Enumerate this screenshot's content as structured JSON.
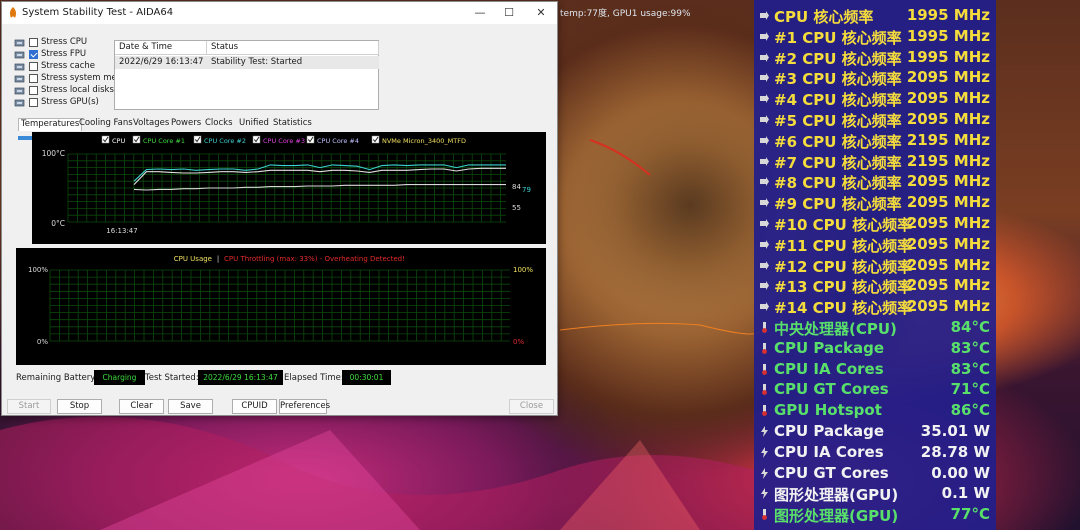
{
  "background": {
    "overlay_text": "temp:77度, GPU1 usage:99%"
  },
  "osd": {
    "rows": [
      {
        "icon": "arrow-right-icon",
        "label": "CPU 核心频率",
        "value": "1995 MHz",
        "color": "#f4dc3c"
      },
      {
        "icon": "arrow-right-icon",
        "label": "#1 CPU 核心频率",
        "value": "1995 MHz",
        "color": "#f4dc3c"
      },
      {
        "icon": "arrow-right-icon",
        "label": "#2 CPU 核心频率",
        "value": "1995 MHz",
        "color": "#f4dc3c"
      },
      {
        "icon": "arrow-right-icon",
        "label": "#3 CPU 核心频率",
        "value": "2095 MHz",
        "color": "#f4dc3c"
      },
      {
        "icon": "arrow-right-icon",
        "label": "#4 CPU 核心频率",
        "value": "2095 MHz",
        "color": "#f4dc3c"
      },
      {
        "icon": "arrow-right-icon",
        "label": "#5 CPU 核心频率",
        "value": "2095 MHz",
        "color": "#f4dc3c"
      },
      {
        "icon": "arrow-right-icon",
        "label": "#6 CPU 核心频率",
        "value": "2195 MHz",
        "color": "#f4dc3c"
      },
      {
        "icon": "arrow-right-icon",
        "label": "#7 CPU 核心频率",
        "value": "2195 MHz",
        "color": "#f4dc3c"
      },
      {
        "icon": "arrow-right-icon",
        "label": "#8 CPU 核心频率",
        "value": "2095 MHz",
        "color": "#f4dc3c"
      },
      {
        "icon": "arrow-right-icon",
        "label": "#9 CPU 核心频率",
        "value": "2095 MHz",
        "color": "#f4dc3c"
      },
      {
        "icon": "arrow-right-icon",
        "label": "#10 CPU 核心频率",
        "value": "2095 MHz",
        "color": "#f4dc3c"
      },
      {
        "icon": "arrow-right-icon",
        "label": "#11 CPU 核心频率",
        "value": "2095 MHz",
        "color": "#f4dc3c"
      },
      {
        "icon": "arrow-right-icon",
        "label": "#12 CPU 核心频率",
        "value": "2095 MHz",
        "color": "#f4dc3c"
      },
      {
        "icon": "arrow-right-icon",
        "label": "#13 CPU 核心频率",
        "value": "2095 MHz",
        "color": "#f4dc3c"
      },
      {
        "icon": "arrow-right-icon",
        "label": "#14 CPU 核心频率",
        "value": "2095 MHz",
        "color": "#f4dc3c"
      },
      {
        "icon": "thermometer-icon",
        "label": "中央处理器(CPU)",
        "value": "84°C",
        "color": "#59e06b"
      },
      {
        "icon": "thermometer-icon",
        "label": "CPU Package",
        "value": "83°C",
        "color": "#59e06b"
      },
      {
        "icon": "thermometer-icon",
        "label": "CPU IA Cores",
        "value": "83°C",
        "color": "#59e06b"
      },
      {
        "icon": "thermometer-icon",
        "label": "CPU GT Cores",
        "value": "71°C",
        "color": "#59e06b"
      },
      {
        "icon": "thermometer-icon",
        "label": "GPU Hotspot",
        "value": "86°C",
        "color": "#59e06b"
      },
      {
        "icon": "power-icon",
        "label": "CPU Package",
        "value": "35.01 W",
        "color": "#f2f2f2"
      },
      {
        "icon": "power-icon",
        "label": "CPU IA Cores",
        "value": "28.78 W",
        "color": "#f2f2f2"
      },
      {
        "icon": "power-icon",
        "label": "CPU GT Cores",
        "value": "0.00 W",
        "color": "#f2f2f2"
      },
      {
        "icon": "power-icon",
        "label": "图形处理器(GPU)",
        "value": "0.1 W",
        "color": "#f2f2f2"
      },
      {
        "icon": "thermometer-icon",
        "label": "图形处理器(GPU)",
        "value": "77°C",
        "color": "#59e06b"
      }
    ]
  },
  "window": {
    "title": "System Stability Test - AIDA64",
    "checkboxes": [
      {
        "label": "Stress CPU",
        "checked": false,
        "icon": "cpu-icon"
      },
      {
        "label": "Stress FPU",
        "checked": true,
        "icon": "fpu-icon"
      },
      {
        "label": "Stress cache",
        "checked": false,
        "icon": "cache-icon"
      },
      {
        "label": "Stress system memory",
        "checked": false,
        "icon": "memory-icon"
      },
      {
        "label": "Stress local disks",
        "checked": false,
        "icon": "disk-icon"
      },
      {
        "label": "Stress GPU(s)",
        "checked": false,
        "icon": "gpu-icon"
      }
    ],
    "status_table": {
      "headers": [
        "Date & Time",
        "Status"
      ],
      "rows": [
        [
          "2022/6/29 16:13:47",
          "Stability Test: Started"
        ]
      ]
    },
    "tabs": [
      "Temperatures",
      "Cooling Fans",
      "Voltages",
      "Powers",
      "Clocks",
      "Unified",
      "Statistics"
    ],
    "active_tab": "Temperatures",
    "footer": {
      "battery_label": "Remaining Battery:",
      "battery_value": "Charging",
      "started_label": "Test Started:",
      "started_value": "2022/6/29 16:13:47",
      "elapsed_label": "Elapsed Time:",
      "elapsed_value": "00:30:01"
    },
    "buttons": {
      "start": "Start",
      "stop": "Stop",
      "clear": "Clear",
      "save": "Save",
      "cpuid": "CPUID",
      "preferences": "Preferences",
      "close": "Close"
    }
  },
  "chart_data": [
    {
      "type": "line",
      "legend": [
        {
          "name": "CPU",
          "color": "#ffffff"
        },
        {
          "name": "CPU Core #1",
          "color": "#3cdc3c"
        },
        {
          "name": "CPU Core #2",
          "color": "#3cd0d0"
        },
        {
          "name": "CPU Core #3",
          "color": "#e040e0"
        },
        {
          "name": "CPU Core #4",
          "color": "#c0c0ff"
        },
        {
          "name": "NVMe Micron_3400_MTFD",
          "color": "#f0e060"
        }
      ],
      "y_top_label": "100°C",
      "y_bottom_label": "0°C",
      "x_label": "16:13:47",
      "ylim": [
        0,
        100
      ],
      "end_labels": [
        "84",
        "79",
        "55"
      ],
      "series": [
        {
          "name": "CPU",
          "color": "#3cd0d0",
          "values": [
            60,
            77,
            78,
            77,
            78,
            76,
            77,
            78,
            78,
            76,
            78,
            84,
            83,
            83,
            84,
            80,
            84,
            83,
            82,
            77,
            83,
            84,
            83,
            84,
            84,
            84,
            80,
            84,
            84,
            84,
            84
          ]
        },
        {
          "name": "CPU Core #4",
          "color": "#e0e0e0",
          "values": [
            55,
            74,
            74,
            73,
            72,
            72,
            73,
            74,
            74,
            73,
            74,
            76,
            76,
            76,
            76,
            74,
            76,
            76,
            75,
            73,
            76,
            76,
            76,
            77,
            78,
            78,
            75,
            78,
            79,
            79,
            79
          ]
        },
        {
          "name": "NVMe Micron_3400_MTFD",
          "color": "#d8d8d8",
          "values": [
            48,
            47,
            48,
            48,
            49,
            49,
            50,
            50,
            50,
            51,
            51,
            52,
            52,
            52,
            53,
            53,
            53,
            54,
            54,
            54,
            54,
            54,
            55,
            55,
            55,
            55,
            55,
            55,
            55,
            55,
            55
          ]
        }
      ]
    },
    {
      "type": "line",
      "title_left": "CPU Usage",
      "title_sep": "|",
      "title_right": "CPU Throttling (max: 33%) - Overheating Detected!",
      "y_left_top": "100%",
      "y_left_bottom": "0%",
      "y_right_top": "100%",
      "y_right_bottom": "0%",
      "ylim": [
        0,
        100
      ],
      "series": []
    }
  ]
}
